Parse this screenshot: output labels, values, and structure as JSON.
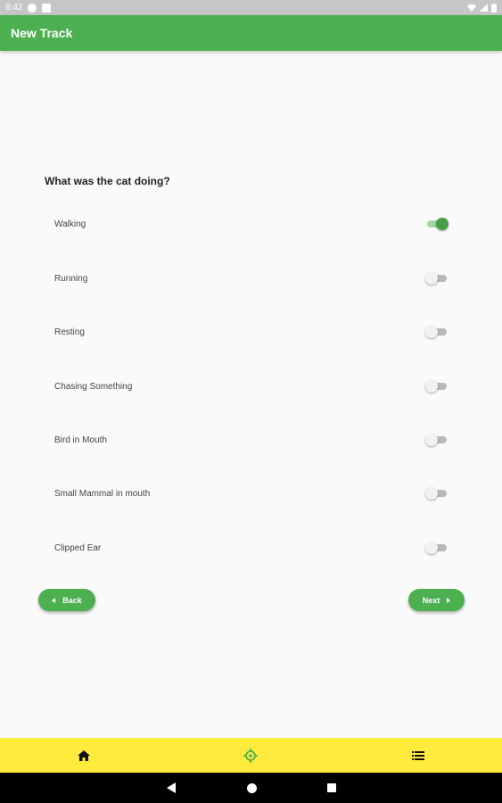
{
  "status_bar": {
    "time": "8:42"
  },
  "app_bar": {
    "title": "New Track"
  },
  "question": "What was the cat doing?",
  "options": [
    {
      "label": "Walking",
      "checked": true
    },
    {
      "label": "Running",
      "checked": false
    },
    {
      "label": "Resting",
      "checked": false
    },
    {
      "label": "Chasing Something",
      "checked": false
    },
    {
      "label": "Bird in Mouth",
      "checked": false
    },
    {
      "label": "Small Mammal in mouth",
      "checked": false
    },
    {
      "label": "Clipped Ear",
      "checked": false
    }
  ],
  "buttons": {
    "back_label": "Back",
    "next_label": "Next"
  },
  "bottom_nav": {
    "items": [
      "home-icon",
      "target-icon",
      "list-icon"
    ]
  },
  "colors": {
    "primary": "#4caf50",
    "accent_bar": "#ffeb3b",
    "switch_on": "#43a047"
  }
}
